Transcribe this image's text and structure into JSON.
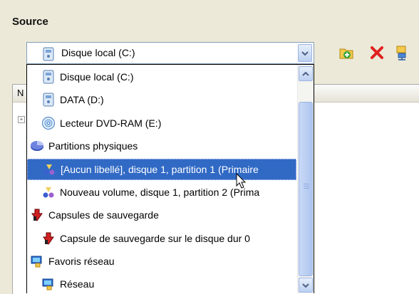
{
  "source": {
    "label": "Source"
  },
  "combo": {
    "selected_label": "Disque local (C:)"
  },
  "background": {
    "column_header": "N"
  },
  "dropdown": {
    "items": [
      {
        "label": "Disque local (C:)",
        "icon": "disk-icon"
      },
      {
        "label": "DATA (D:)",
        "icon": "disk-icon"
      },
      {
        "label": "Lecteur DVD-RAM (E:)",
        "icon": "dvd-icon"
      },
      {
        "label": "Partitions physiques",
        "icon": "physical-partitions-icon"
      },
      {
        "label": "[Aucun libellé], disque 1, partition 1 (Primaire",
        "icon": "partition-icon"
      },
      {
        "label": "Nouveau volume, disque 1, partition 2 (Prima",
        "icon": "partition-icon"
      },
      {
        "label": "Capsules de sauvegarde",
        "icon": "backup-capsule-icon"
      },
      {
        "label": "Capsule de sauvegarde sur le disque dur 0",
        "icon": "backup-capsule-icon"
      },
      {
        "label": "Favoris réseau",
        "icon": "network-favorites-icon"
      },
      {
        "label": "Réseau",
        "icon": "network-icon"
      }
    ],
    "selected_index": 4
  },
  "colors": {
    "selection": "#316ac5",
    "window_bg": "#ece9d8",
    "combo_border": "#7f9db9"
  }
}
